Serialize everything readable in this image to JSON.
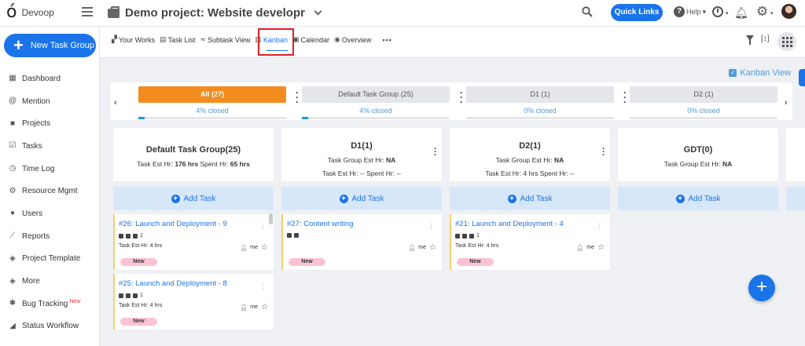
{
  "app": {
    "logo_glyph": "ó",
    "name": "Devoop",
    "project_title": "Demo project: Website developr",
    "quick_links": "Quick Links",
    "help": "Help",
    "accent": "#1a73e8"
  },
  "sidebar": {
    "new_button": "New Task Group",
    "items": [
      {
        "label": "Dashboard",
        "icon": "dashboard-icon"
      },
      {
        "label": "Mention",
        "icon": "at-icon"
      },
      {
        "label": "Projects",
        "icon": "briefcase-icon"
      },
      {
        "label": "Tasks",
        "icon": "checkbox-icon"
      },
      {
        "label": "Time Log",
        "icon": "clock-icon"
      },
      {
        "label": "Resource Mgmt",
        "icon": "resource-icon"
      },
      {
        "label": "Users",
        "icon": "user-icon"
      },
      {
        "label": "Reports",
        "icon": "chart-line-icon"
      },
      {
        "label": "Project Template",
        "icon": "layers-icon"
      },
      {
        "label": "More",
        "icon": "layers-icon"
      },
      {
        "label": "Bug Tracking",
        "icon": "bug-icon",
        "badge": "New"
      },
      {
        "label": "Status Workflow",
        "icon": "workflow-icon"
      }
    ]
  },
  "views": [
    {
      "label": "Your Works"
    },
    {
      "label": "Task List"
    },
    {
      "label": "Subtask View"
    },
    {
      "label": "Kanban"
    },
    {
      "label": "Calendar"
    },
    {
      "label": "Overview"
    }
  ],
  "kanban_label": "Kanban View",
  "group_tabs": [
    {
      "label": "All",
      "count": "(27)",
      "pct": "4% closed",
      "progress": 0.04
    },
    {
      "label": "Default Task Group",
      "count": "(25)",
      "pct": "4% closed",
      "progress": 0.04
    },
    {
      "label": "D1",
      "count": "(1)",
      "pct": "0% closed",
      "progress": 0
    },
    {
      "label": "D2",
      "count": "(1)",
      "pct": "0% closed",
      "progress": 0
    }
  ],
  "columns": [
    {
      "title": "Default Task Group(25)",
      "line1_label": "Task Est Hr: ",
      "line1_value": "176 hrs",
      "line1b_label": "Spent Hr: ",
      "line1b_value": "65 hrs",
      "line2": "",
      "add": "Add Task"
    },
    {
      "title": "D1(1)",
      "line1_label": "Task Group Est Hr: ",
      "line1_value": "NA",
      "line2": "Task Est Hr: --    Spent Hr: --",
      "add": "Add Task"
    },
    {
      "title": "D2(1)",
      "line1_label": "Task Group Est Hr: ",
      "line1_value": "NA",
      "line2": "Task Est Hr: 4 hrs    Spent Hr: --",
      "add": "Add Task"
    },
    {
      "title": "GDT(0)",
      "line1_label": "Task Group Est Hr: ",
      "line1_value": "NA",
      "line2": "",
      "add": "Add Task"
    }
  ],
  "cards": [
    {
      "col": 0,
      "title": "#26: Launch and Deployment - 9",
      "count": "1",
      "est": "Task Est Hr: 4 hrs",
      "assignee": "me",
      "status": "New"
    },
    {
      "col": 0,
      "title": "#25: Launch and Deployment - 8",
      "count": "1",
      "est": "Task Est Hr: 4 hrs",
      "assignee": "me",
      "status": "New"
    },
    {
      "col": 1,
      "title": "#27: Content writing",
      "count": "",
      "est": "",
      "assignee": "me",
      "status": "New"
    },
    {
      "col": 2,
      "title": "#21: Launch and Deployment - 4",
      "count": "1",
      "est": "Task Est Hr: 4 hrs",
      "assignee": "me",
      "status": "New"
    }
  ]
}
